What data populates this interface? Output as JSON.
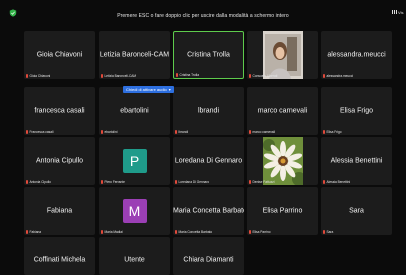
{
  "banner": "Premere ESC o fare doppio clic per uscire dalla modalità a schermo intero",
  "top_button_label": "Vis",
  "tooltip": "Chiedi di attivare audio",
  "colors": {
    "active_border": "#5ecb4c",
    "mic_muted": "#e14a3b",
    "tile_bg": "#1c1c1c",
    "tooltip_bg": "#2d6fe0"
  },
  "tiles": [
    {
      "name": "Gioia Chiavoni",
      "label": "Gioia Chiavoni"
    },
    {
      "name": "Letizia Baronceli-CAM",
      "label": "Letizia Baronceli-CAM"
    },
    {
      "name": "Cristina Trolla",
      "label": "Cristina Trolla",
      "active": true
    },
    {
      "name": "",
      "label": "Consuelo Liberati",
      "video": "woman-webcam"
    },
    {
      "name": "alessandra.meucci",
      "label": "alessandra.meucci"
    },
    {
      "name": "francesca casali",
      "label": "Francesca casali"
    },
    {
      "name": "ebartolini",
      "label": "ebartolini"
    },
    {
      "name": "lbrandi",
      "label": "lbrandi"
    },
    {
      "name": "marco carnevali",
      "label": "marco carnevali"
    },
    {
      "name": "Elisa Frigo",
      "label": "Elisa Frigo"
    },
    {
      "name": "Antonia Cipullo",
      "label": "Antonia Cipullo"
    },
    {
      "name": "",
      "label": "Piero Ferrante",
      "avatar": "P",
      "avatar_color": "#1f9b8a"
    },
    {
      "name": "Loredana Di Gennaro",
      "label": "Loredana Di Gennaro"
    },
    {
      "name": "",
      "label": "Denise Fattuzzi",
      "video": "flower-picture"
    },
    {
      "name": "Alessia Benettini",
      "label": "Alessia Benettini"
    },
    {
      "name": "Fabiana",
      "label": "Fabiana"
    },
    {
      "name": "",
      "label": "Maria Madiai",
      "avatar": "M",
      "avatar_color": "#9b3fb5"
    },
    {
      "name": "Maria Concetta Barbato",
      "label": "Maria Concetta Barbato"
    },
    {
      "name": "Elisa Parrino",
      "label": "Elisa Parrino"
    },
    {
      "name": "Sara",
      "label": "Sara"
    },
    {
      "name": "Coffinati Michela",
      "label": ""
    },
    {
      "name": "Utente",
      "label": ""
    },
    {
      "name": "Chiara Diamanti",
      "label": ""
    }
  ]
}
